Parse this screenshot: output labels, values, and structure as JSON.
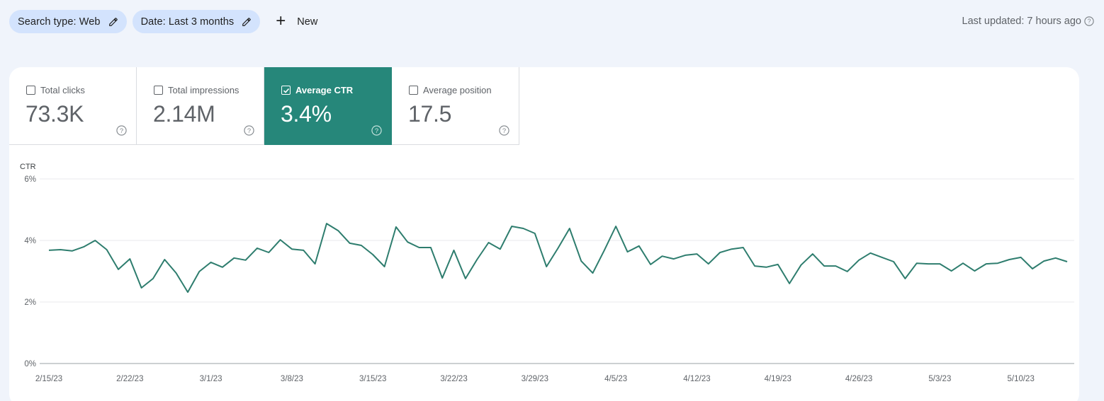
{
  "filters": {
    "chips": [
      {
        "label": "Search type: Web",
        "icon": "pencil-icon"
      },
      {
        "label": "Date: Last 3 months",
        "icon": "pencil-icon"
      }
    ],
    "new_label": "New",
    "new_icon": "plus-icon"
  },
  "last_updated": {
    "text": "Last updated: 7 hours ago",
    "icon": "help-icon"
  },
  "metrics": [
    {
      "label": "Total clicks",
      "value": "73.3K",
      "checked": false
    },
    {
      "label": "Total impressions",
      "value": "2.14M",
      "checked": false
    },
    {
      "label": "Average CTR",
      "value": "3.4%",
      "checked": true
    },
    {
      "label": "Average position",
      "value": "17.5",
      "checked": false
    }
  ],
  "colors": {
    "active_metric": "#26877a",
    "line": "#2e7d6e",
    "chip_bg": "#d3e3fd",
    "page_bg": "#f0f4fb"
  },
  "chart_data": {
    "type": "line",
    "title": "",
    "ylabel": "CTR",
    "xlabel": "",
    "ylim": [
      0,
      6
    ],
    "yticks": [
      "0%",
      "2%",
      "4%",
      "6%"
    ],
    "ytick_values": [
      0,
      2,
      4,
      6
    ],
    "grid": true,
    "start_date": "2/15/23",
    "xtick_labels": [
      "2/15/23",
      "2/22/23",
      "3/1/23",
      "3/8/23",
      "3/15/23",
      "3/22/23",
      "3/29/23",
      "4/5/23",
      "4/12/23",
      "4/19/23",
      "4/26/23",
      "5/3/23",
      "5/10/23"
    ],
    "xtick_indices": [
      0,
      7,
      14,
      21,
      28,
      35,
      42,
      49,
      56,
      63,
      70,
      77,
      84
    ],
    "series": [
      {
        "name": "Average CTR",
        "unit": "%",
        "values": [
          3.68,
          3.7,
          3.66,
          3.79,
          4.0,
          3.7,
          3.06,
          3.4,
          2.46,
          2.76,
          3.38,
          2.94,
          2.32,
          2.99,
          3.29,
          3.13,
          3.43,
          3.36,
          3.75,
          3.61,
          4.02,
          3.72,
          3.68,
          3.24,
          4.55,
          4.32,
          3.91,
          3.84,
          3.54,
          3.15,
          4.44,
          3.95,
          3.77,
          3.77,
          2.78,
          3.68,
          2.76,
          3.38,
          3.93,
          3.72,
          4.46,
          4.39,
          4.23,
          3.15,
          3.75,
          4.39,
          3.33,
          2.94,
          3.68,
          4.46,
          3.63,
          3.82,
          3.22,
          3.49,
          3.4,
          3.52,
          3.56,
          3.24,
          3.61,
          3.72,
          3.77,
          3.17,
          3.13,
          3.22,
          2.6,
          3.2,
          3.56,
          3.17,
          3.17,
          2.99,
          3.36,
          3.59,
          3.45,
          3.31,
          2.76,
          3.26,
          3.24,
          3.24,
          3.01,
          3.26,
          3.01,
          3.24,
          3.26,
          3.38,
          3.45,
          3.08,
          3.33,
          3.43,
          3.31
        ]
      }
    ]
  }
}
